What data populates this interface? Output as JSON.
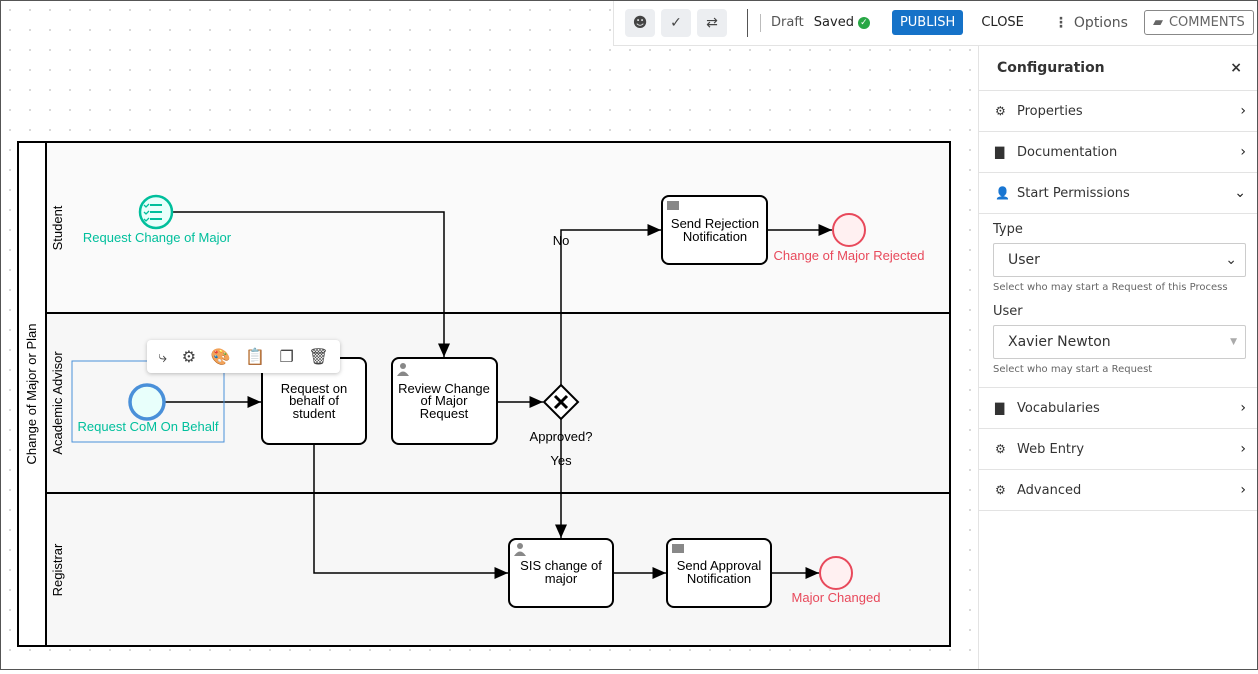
{
  "toolbar": {
    "status": "Draft",
    "saved": "Saved",
    "publish": "PUBLISH",
    "close": "CLOSE",
    "options": "Options",
    "comments": "COMMENTS"
  },
  "panel": {
    "title": "Configuration",
    "sections": {
      "properties": "Properties",
      "documentation": "Documentation",
      "start_permissions": "Start Permissions",
      "vocabularies": "Vocabularies",
      "web_entry": "Web Entry",
      "advanced": "Advanced"
    },
    "form": {
      "type_label": "Type",
      "type_value": "User",
      "type_help": "Select who may start a Request of this Process",
      "user_label": "User",
      "user_value": "Xavier Newton",
      "user_help": "Select who may start a Request"
    }
  },
  "diagram": {
    "pool": "Change of Major or Plan",
    "lanes": {
      "student": "Student",
      "advisor": "Academic Advisor",
      "registrar": "Registrar"
    },
    "start_student": "Request Change of Major",
    "start_advisor": "Request CoM On Behalf",
    "task_behalf": [
      "Request on",
      "behalf of",
      "student"
    ],
    "task_review": [
      "Review Change",
      "of Major",
      "Request"
    ],
    "gateway": "Approved?",
    "yes": "Yes",
    "no": "No",
    "task_reject": [
      "Send Rejection",
      "Notification"
    ],
    "end_reject": "Change of Major Rejected",
    "task_sis": [
      "SIS change of",
      "major"
    ],
    "task_approve": [
      "Send Approval",
      "Notification"
    ],
    "end_changed": "Major Changed"
  },
  "colors": {
    "start": "#00bf9c",
    "end": "#e8495b",
    "accent": "#1572c8"
  }
}
